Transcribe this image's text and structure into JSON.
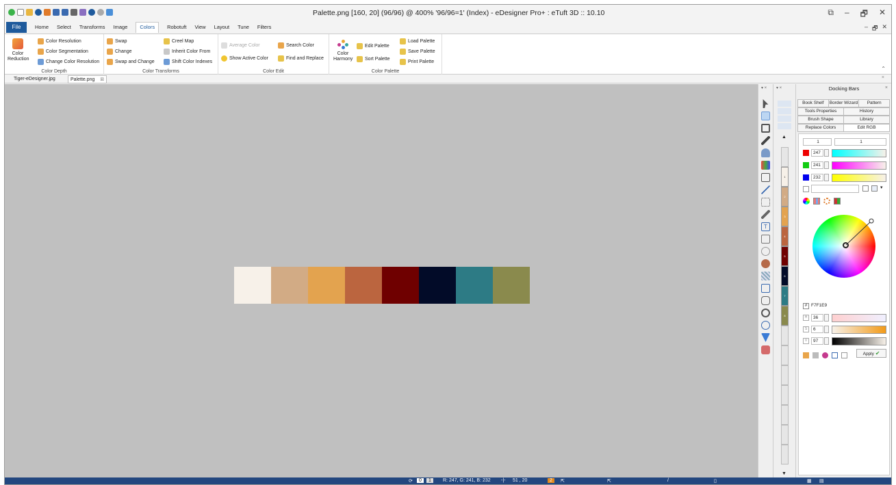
{
  "window": {
    "title": "Palette.png [160, 20] (96/96) @ 400% '96/96=1' (Index) - eDesigner Pro+ : eTuft 3D :: 10.10",
    "controls": [
      "⧉",
      "–",
      "🗗",
      "✕"
    ],
    "mdi_controls": [
      "–",
      "🗗",
      "✕"
    ]
  },
  "menu": {
    "file": "File",
    "tabs": [
      "Home",
      "Select",
      "Transforms",
      "Image",
      "Colors",
      "Robotuft",
      "View",
      "Layout",
      "Tune",
      "Filters"
    ],
    "active_tab": "Colors"
  },
  "ribbon": {
    "color_depth": {
      "label": "Color Depth",
      "big_button_line1": "Color",
      "big_button_line2": "Reduction",
      "items": [
        "Color Resolution",
        "Color Segmentation",
        "Change Color Resolution"
      ]
    },
    "color_transforms": {
      "label": "Color Transforms",
      "col1": [
        "Swap",
        "Change",
        "Swap and Change"
      ],
      "col2": [
        "Creel Map",
        "Inherit Color From",
        "Shift Color Indexes"
      ]
    },
    "color_edit": {
      "label": "Color Edit",
      "items": [
        "Average Color",
        "Search Color",
        "Show Active Color",
        "Find and Replace"
      ]
    },
    "color_palette": {
      "label": "Color Palette",
      "harmony_line1": "Color",
      "harmony_line2": "Harmony",
      "items": [
        "Edit Palette",
        "Sort Palette",
        "Load Palette",
        "Save Palette",
        "Print Palette"
      ]
    }
  },
  "doc_tabs": [
    "Tiger-eDesigner.jpg",
    "Palette.png"
  ],
  "canvas": {
    "background": "#c0c0c0",
    "swatches": [
      "#f7f1e9",
      "#d2ab85",
      "#e3a34f",
      "#bb653f",
      "#6f0000",
      "#020b28",
      "#2d7b85",
      "#8a8a4d"
    ]
  },
  "palette_strip": {
    "indices": [
      "1",
      "2",
      "3",
      "4",
      "5",
      "6",
      "7",
      "8"
    ]
  },
  "dock": {
    "title": "Docking Bars",
    "tab_rows": [
      [
        "Book Shelf",
        "Border Wizard",
        "Pattern"
      ],
      [
        "Tools Properties",
        "History"
      ],
      [
        "Brush Shape",
        "Library"
      ],
      [
        "Replace Colors",
        "Edit RGB"
      ]
    ],
    "active_tab": "Edit RGB",
    "index_fields": [
      "1",
      "1"
    ],
    "r_value": "247",
    "g_value": "241",
    "b_value": "232",
    "hex_value": "F7F1E9",
    "h_value": "36",
    "s_value": "6",
    "v_value": "97",
    "apply_label": "Apply"
  },
  "status": {
    "page_fields": [
      "0",
      "1"
    ],
    "rgb": "R: 247, G: 241, B: 232",
    "coords": "51 , 20",
    "index": "2"
  },
  "colors": {
    "accent": "#1e5a9c",
    "statusbar": "#23477f"
  }
}
